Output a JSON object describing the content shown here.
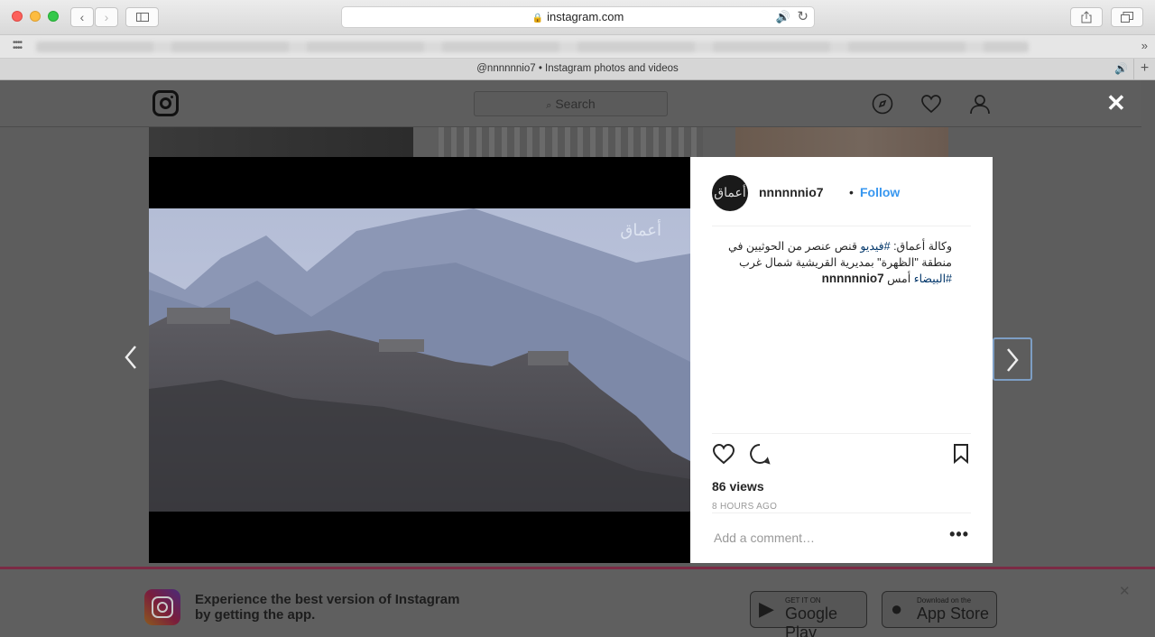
{
  "browser": {
    "url": "instagram.com",
    "tab_title": "@nnnnnnio7 • Instagram photos and videos"
  },
  "instagram": {
    "search_placeholder": "Search"
  },
  "post": {
    "username": "nnnnnnio7",
    "separator": "•",
    "follow_label": "Follow",
    "avatar_text": "أعماق",
    "caption_prefix": "وكالة أعماق: ",
    "caption_tag1": "#فيديو",
    "caption_middle": " قنص عنصر من الحوثيين في منطقة \"الظهرة\" بمديرية القريشية شمال غرب ",
    "caption_tag2": "#البيضاء",
    "caption_suffix": " أمس",
    "views": "86 views",
    "time": "8 HOURS AGO",
    "comment_placeholder": "Add a comment…",
    "watermark": "أعماق"
  },
  "banner": {
    "text": "Experience the best version of Instagram by getting the app.",
    "google_small": "GET IT ON",
    "google_big": "Google Play",
    "apple_small": "Download on the",
    "apple_big": "App Store"
  },
  "icons": {
    "back": "‹",
    "forward": "›",
    "close": "✕",
    "prev": "‹",
    "next": "›"
  }
}
